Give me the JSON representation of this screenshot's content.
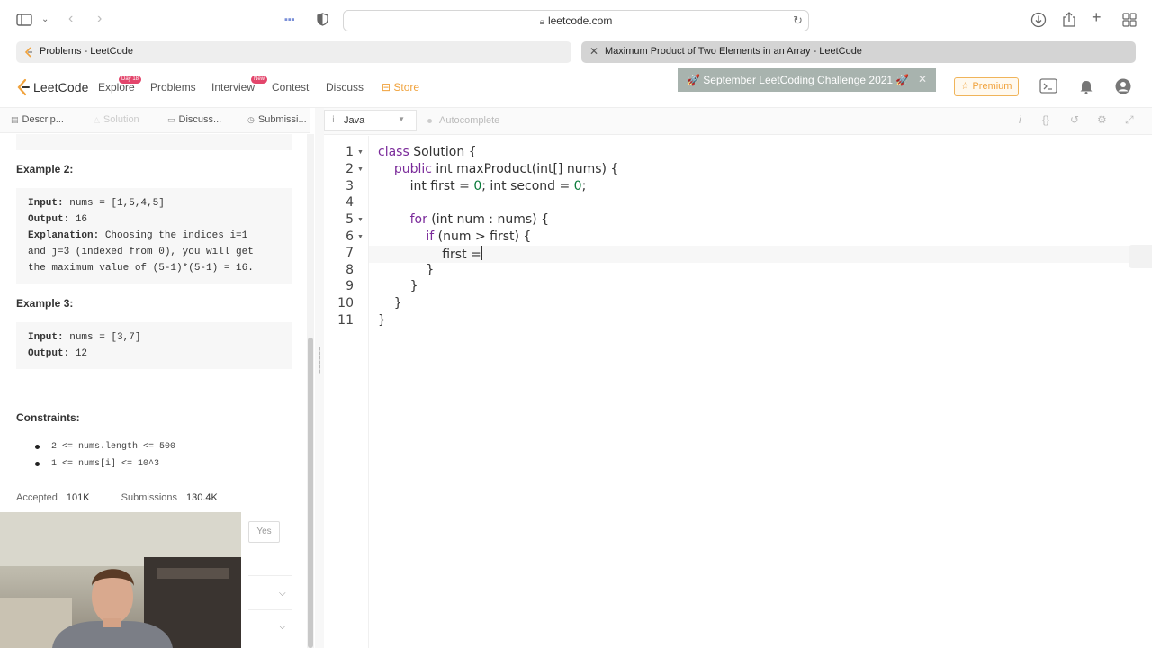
{
  "browser": {
    "url": "leetcode.com",
    "tabs": [
      {
        "title": "Problems - LeetCode",
        "active": false
      },
      {
        "title": "Maximum Product of Two Elements in an Array - LeetCode",
        "active": true
      }
    ]
  },
  "header": {
    "logo_text": "LeetCode",
    "nav": [
      {
        "label": "Explore",
        "badge": "Day 18"
      },
      {
        "label": "Problems",
        "badge": ""
      },
      {
        "label": "Interview",
        "badge": "New"
      },
      {
        "label": "Contest",
        "badge": ""
      },
      {
        "label": "Discuss",
        "badge": ""
      },
      {
        "label": "Store",
        "badge": ""
      }
    ],
    "challenge": "🚀 September LeetCoding Challenge 2021 🚀",
    "premium": "☆ Premium"
  },
  "left_tabs": [
    "Descrip...",
    "Solution",
    "Discuss...",
    "Submissi..."
  ],
  "problem": {
    "example2": {
      "title": "Example 2:",
      "input_label": "Input:",
      "input": "nums = [1,5,4,5]",
      "output_label": "Output:",
      "output": "16",
      "explanation_label": "Explanation:",
      "explanation_1": "Choosing the indices i=1",
      "explanation_2": "and j=3 (indexed from 0), you will get",
      "explanation_3": "the maximum value of (5-1)*(5-1) = 16."
    },
    "example3": {
      "title": "Example 3:",
      "input_label": "Input:",
      "input": "nums = [3,7]",
      "output_label": "Output:",
      "output": "12"
    },
    "constraints_title": "Constraints:",
    "constraints": [
      "2 <= nums.length <= 500",
      "1 <= nums[i] <= 10^3"
    ],
    "accepted_label": "Accepted",
    "accepted": "101K",
    "submissions_label": "Submissions",
    "submissions": "130.4K",
    "yes_label": "Yes"
  },
  "editor": {
    "language": "Java",
    "autocomplete": "Autocomplete",
    "line_numbers": [
      "1",
      "2",
      "3",
      "4",
      "5",
      "6",
      "7",
      "8",
      "9",
      "10",
      "11"
    ]
  },
  "colors": {
    "keyword": "#7a2a9a",
    "number": "#0a7a3a",
    "store": "#f0a23c",
    "badge": "#e3456b"
  }
}
